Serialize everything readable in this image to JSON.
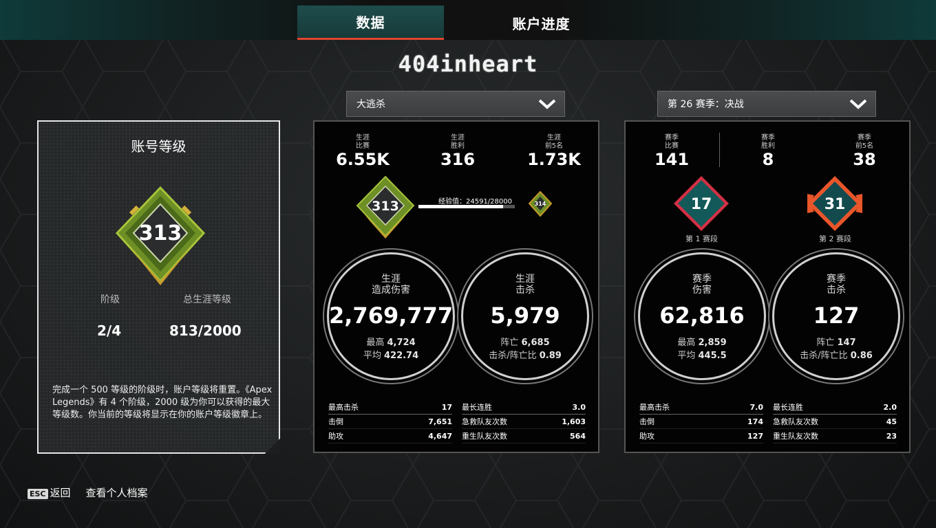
{
  "tabs": [
    {
      "label": "数据",
      "active": true
    },
    {
      "label": "账户进度",
      "active": false
    }
  ],
  "player_name": "404inheart",
  "mode_dropdown": {
    "value": "大逃杀"
  },
  "season_dropdown": {
    "value": "第 26 赛季：决战"
  },
  "account": {
    "title": "账号等级",
    "level": "313",
    "tier_label": "阶级",
    "tier_value": "2/4",
    "total_label": "总生涯等级",
    "total_value": "813/2000",
    "description": "完成一个 500 等级的阶级时，账户等级将重置。《Apex Legends》有 4 个阶级，2000 级为你可以获得的最大等级数。你当前的等级将显示在你的账户等级徽章上。"
  },
  "career": {
    "top": [
      {
        "label": "生涯\n比赛",
        "value": "6.55K"
      },
      {
        "label": "生涯\n胜利",
        "value": "316"
      },
      {
        "label": "生涯\n前5名",
        "value": "1.73K"
      }
    ],
    "level": "313",
    "next_level": "314",
    "xp_text": "经验值：24591/28000",
    "xp_progress": 0.878,
    "damage": {
      "title": "生涯\n造成伤害",
      "value": "2,769,777",
      "line1_label": "最高",
      "line1_value": "4,724",
      "line2_label": "平均",
      "line2_value": "422.74"
    },
    "kills": {
      "title": "生涯\n击杀",
      "value": "5,979",
      "line1_label": "阵亡",
      "line1_value": "6,685",
      "line2_label": "击杀/阵亡比",
      "line2_value": "0.89"
    },
    "left_table": [
      {
        "label": "最高击杀",
        "value": "17"
      },
      {
        "label": "击倒",
        "value": "7,651"
      },
      {
        "label": "助攻",
        "value": "4,647"
      }
    ],
    "right_table": [
      {
        "label": "最长连胜",
        "value": "3.0"
      },
      {
        "label": "急救队友次数",
        "value": "1,603"
      },
      {
        "label": "重生队友次数",
        "value": "564"
      }
    ]
  },
  "season": {
    "top": [
      {
        "label": "赛季\n比赛",
        "value": "141"
      },
      {
        "label": "赛季\n胜利",
        "value": "8"
      },
      {
        "label": "赛季\n前5名",
        "value": "38"
      }
    ],
    "split1": {
      "rank": "17",
      "label": "第 1 赛段"
    },
    "split2": {
      "rank": "31",
      "label": "第 2 赛段"
    },
    "damage": {
      "title": "赛季\n伤害",
      "value": "62,816",
      "line1_label": "最高",
      "line1_value": "2,859",
      "line2_label": "平均",
      "line2_value": "445.5"
    },
    "kills": {
      "title": "赛季\n击杀",
      "value": "127",
      "line1_label": "阵亡",
      "line1_value": "147",
      "line2_label": "击杀/阵亡比",
      "line2_value": "0.86"
    },
    "left_table": [
      {
        "label": "最高击杀",
        "value": "7.0"
      },
      {
        "label": "击倒",
        "value": "174"
      },
      {
        "label": "助攻",
        "value": "127"
      }
    ],
    "right_table": [
      {
        "label": "最长连胜",
        "value": "2.0"
      },
      {
        "label": "急救队友次数",
        "value": "45"
      },
      {
        "label": "重生队友次数",
        "value": "23"
      }
    ]
  },
  "footer": {
    "esc_key": "ESC",
    "back_label": "返回",
    "profile_label": "查看个人档案"
  },
  "colors": {
    "accent": "#e0452f",
    "tab_active": "#1d4d4c",
    "badge_green": "#7fa52a",
    "rank_red": "#d43044",
    "rank_orange": "#e8562a"
  }
}
